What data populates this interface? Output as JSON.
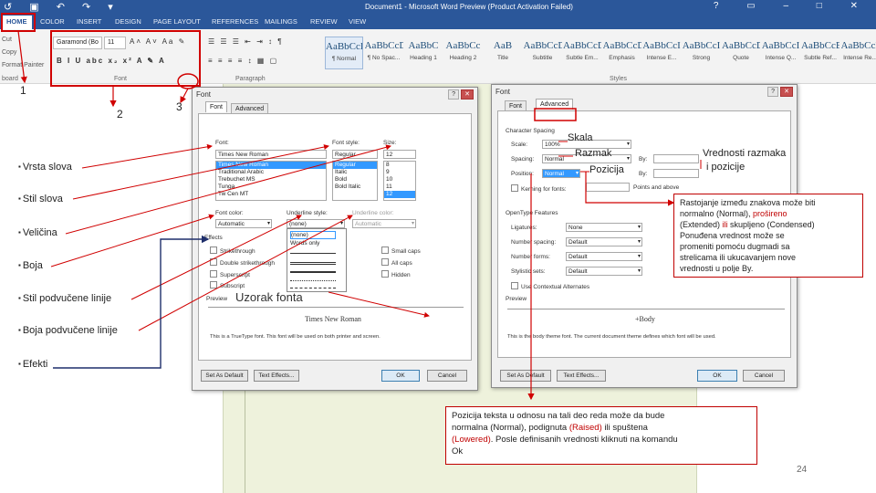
{
  "window": {
    "title": "Document1 - Microsoft Word Preview (Product Activation Failed)",
    "quick_access": [
      "↺",
      "▣",
      "↶",
      "↷",
      "▾"
    ],
    "controls": [
      "?",
      "▭",
      "–",
      "□",
      "✕"
    ]
  },
  "ribbon": {
    "tabs": [
      "HOME",
      "COLOR",
      "INSERT",
      "DESIGN",
      "PAGE LAYOUT",
      "REFERENCES",
      "MAILINGS",
      "REVIEW",
      "VIEW"
    ],
    "clipboard": [
      "Cut",
      "Copy",
      "Format Painter"
    ],
    "groups": [
      "board",
      "Font",
      "Paragraph",
      "Styles"
    ],
    "font_name": "Garamond (Bo",
    "font_size": "11",
    "styles": [
      {
        "sample": "AaBbCcD",
        "name": "¶ Normal"
      },
      {
        "sample": "AaBbCcD",
        "name": "¶ No Spac..."
      },
      {
        "sample": "AaBbC",
        "name": "Heading 1"
      },
      {
        "sample": "AaBbCc",
        "name": "Heading 2"
      },
      {
        "sample": "AaB",
        "name": "Title"
      },
      {
        "sample": "AaBbCcDi",
        "name": "Subtitle"
      },
      {
        "sample": "AaBbCcDi",
        "name": "Subtle Em..."
      },
      {
        "sample": "AaBbCcDi",
        "name": "Emphasis"
      },
      {
        "sample": "AaBbCcI",
        "name": "Intense E..."
      },
      {
        "sample": "AaBbCcI",
        "name": "Strong"
      },
      {
        "sample": "AaBbCcDi",
        "name": "Quote"
      },
      {
        "sample": "AaBbCcI",
        "name": "Intense Q..."
      },
      {
        "sample": "AaBbCcE",
        "name": "Subtle Ref..."
      },
      {
        "sample": "AaBbCcE",
        "name": "Intense Re..."
      }
    ]
  },
  "font_dialog": {
    "title": "Font",
    "tabs": [
      "Font",
      "Advanced"
    ],
    "font_label": "Font:",
    "font_value": "Times New Roman",
    "font_list": [
      "Times New Roman",
      "Traditional Arabic",
      "Trebuchet MS",
      "Tunga",
      "Tw Cen MT"
    ],
    "style_label": "Font style:",
    "style_value": "Regular",
    "style_list": [
      "Regular",
      "Italic",
      "Bold",
      "Bold Italic"
    ],
    "size_label": "Size:",
    "size_value": "12",
    "size_list": [
      "8",
      "9",
      "10",
      "11",
      "12"
    ],
    "color_label": "Font color:",
    "color_value": "Automatic",
    "underline_label": "Underline style:",
    "underline_value": "(none)",
    "underline_color_label": "Underline color:",
    "underline_color_value": "Automatic",
    "underline_options": [
      "(none)",
      "Words only"
    ],
    "effects_label": "Effects",
    "effects_left": [
      "Strikethrough",
      "Double strikethrough",
      "Superscript",
      "Subscript"
    ],
    "effects_right": [
      "Small caps",
      "All caps",
      "Hidden"
    ],
    "preview_label": "Preview",
    "preview_text": "Times New Roman",
    "note": "This is a TrueType font. This font will be used on both printer and screen.",
    "buttons": {
      "default": "Set As Default",
      "effects": "Text Effects...",
      "ok": "OK",
      "cancel": "Cancel"
    }
  },
  "advanced_dialog": {
    "title": "Font",
    "tabs": [
      "Font",
      "Advanced"
    ],
    "spacing_header": "Character Spacing",
    "scale_label": "Scale:",
    "scale_value": "100%",
    "spacing_label": "Spacing:",
    "spacing_value": "Normal",
    "position_label": "Position:",
    "position_value": "Normal",
    "by_label": "By:",
    "kerning_label": "Kerning for fonts:",
    "kerning_suffix": "Points and above",
    "opentype_header": "OpenType Features",
    "ligatures_label": "Ligatures:",
    "ligatures_value": "None",
    "number_spacing_label": "Number spacing:",
    "number_spacing_value": "Default",
    "number_forms_label": "Number forms:",
    "number_forms_value": "Default",
    "stylistic_label": "Stylistic sets:",
    "stylistic_value": "Default",
    "contextual_label": "Use Contextual Alternates",
    "preview_label": "Preview",
    "preview_text": "+Body",
    "note": "This is the body theme font. The current document theme defines which font will be used.",
    "buttons": {
      "default": "Set As Default",
      "effects": "Text Effects...",
      "ok": "OK",
      "cancel": "Cancel"
    }
  },
  "annotations": {
    "numbers": [
      "1",
      "2",
      "3"
    ],
    "bullets": [
      "Vrsta slova",
      "Stil slova",
      "Veličina",
      "Boja",
      "Stil podvučene linije",
      "Boja podvučene linije",
      "Efekti"
    ],
    "sample_label": "Uzorak fonta",
    "skala": "Skala",
    "razmak": "Razmak",
    "pozicija": "Pozicija",
    "vrednosti_line1": "Vrednosti razmaka",
    "vrednosti_line2": "i pozicije",
    "spacing_callout": [
      {
        "parts": [
          {
            "t": "Rastojanje između znakova može biti"
          }
        ]
      },
      {
        "parts": [
          {
            "t": "normalno (Normal), "
          },
          {
            "t": "prošireno",
            "red": true
          }
        ]
      },
      {
        "parts": [
          {
            "t": "(Extended) "
          },
          {
            "t": "ili",
            "red": true
          },
          {
            "t": " skupljeno (Condensed)"
          }
        ]
      },
      {
        "parts": [
          {
            "t": "Ponuđena vrednost može se"
          }
        ]
      },
      {
        "parts": [
          {
            "t": "promeniti pomoću dugmadi sa"
          }
        ]
      },
      {
        "parts": [
          {
            "t": "strelicama ili ukucavanjem nove"
          }
        ]
      },
      {
        "parts": [
          {
            "t": "vrednosti u polje By."
          }
        ]
      }
    ],
    "position_callout": [
      {
        "parts": [
          {
            "t": "Pozicija teksta u odnosu na tali deo reda može da bude"
          }
        ]
      },
      {
        "parts": [
          {
            "t": "normalna (Normal), podignuta "
          },
          {
            "t": "(Raised)",
            "red": true
          },
          {
            "t": " ili spuštena"
          }
        ]
      },
      {
        "parts": [
          {
            "t": "(Lowered)",
            "red": true
          },
          {
            "t": ". Posle definisanih vrednosti kliknuti na komandu"
          }
        ]
      },
      {
        "parts": [
          {
            "t": "Ok"
          }
        ]
      }
    ]
  },
  "page_number": "24",
  "colors": {
    "ribbon_blue": "#2b579a",
    "annotation_red": "#d00000",
    "annotation_blue": "#1f2f6b"
  }
}
